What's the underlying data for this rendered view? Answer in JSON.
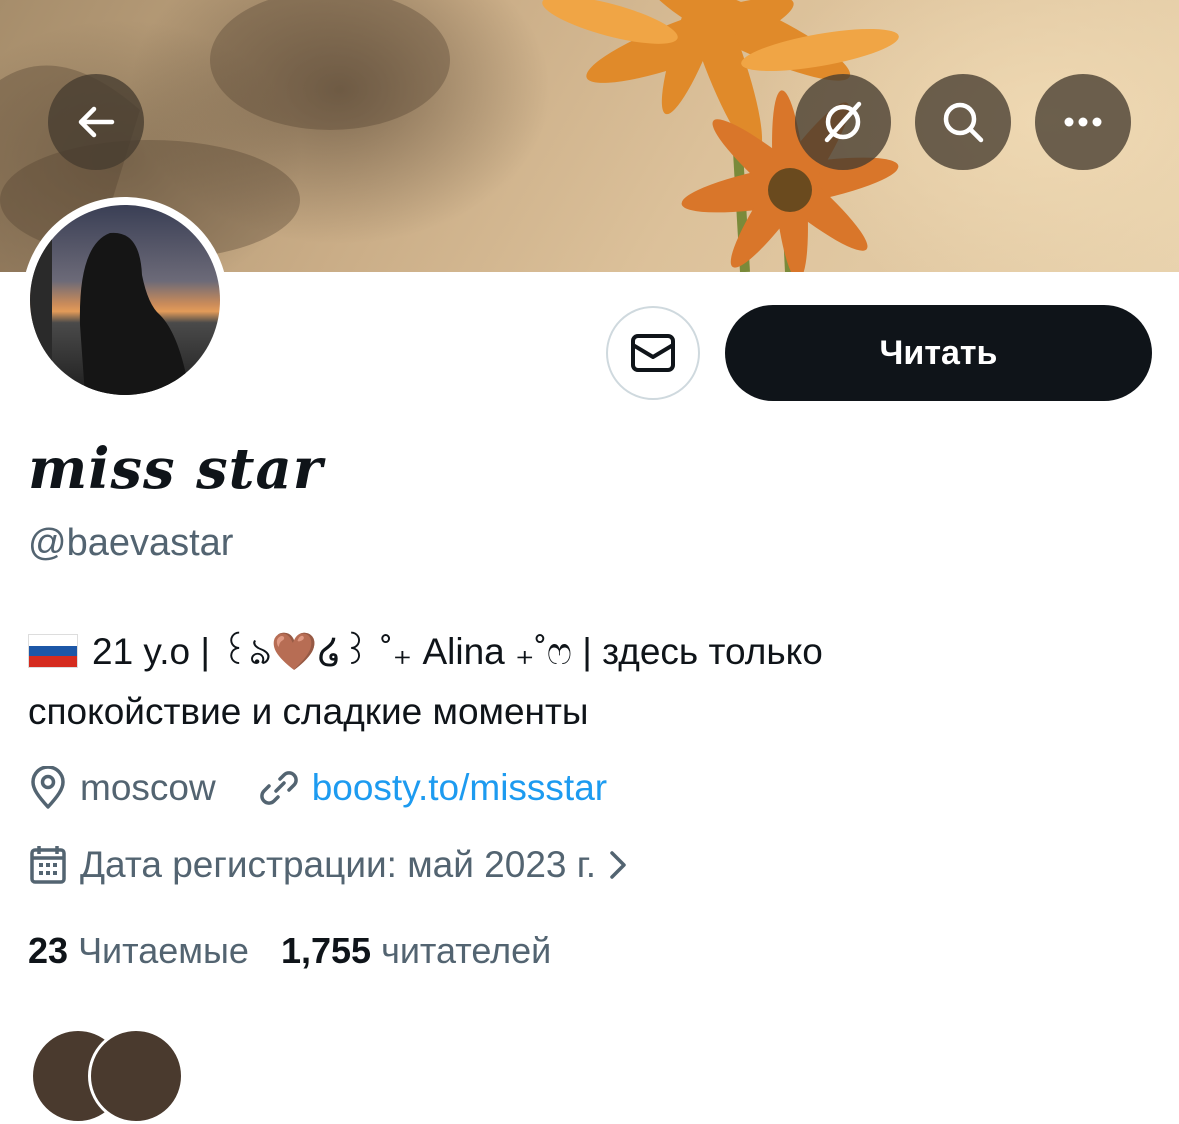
{
  "header": {
    "back_icon": "arrow-left-icon",
    "grok_icon": "grok-icon",
    "search_icon": "search-icon",
    "more_icon": "more-horizontal-icon"
  },
  "profile": {
    "display_name": "miss star",
    "handle": "@baevastar",
    "bio_line1": "21 y.o | ꒰ঌ🤎໒꒱ ˚₊ Alina ₊˚ෆ | здесь только",
    "bio_line2": "спокойствие и сладкие моменты",
    "location": "moscow",
    "website": "boosty.to/missstar",
    "joined": "Дата регистрации: май 2023 г."
  },
  "actions": {
    "message_icon": "mail-icon",
    "follow_label": "Читать"
  },
  "stats": {
    "following_count": "23",
    "following_label": "Читаемые",
    "followers_count": "1,755",
    "followers_label": "читателей"
  },
  "colors": {
    "primary_text": "#0f1419",
    "secondary_text": "#536471",
    "link": "#1d9bf0",
    "button_bg": "#0f1419"
  }
}
